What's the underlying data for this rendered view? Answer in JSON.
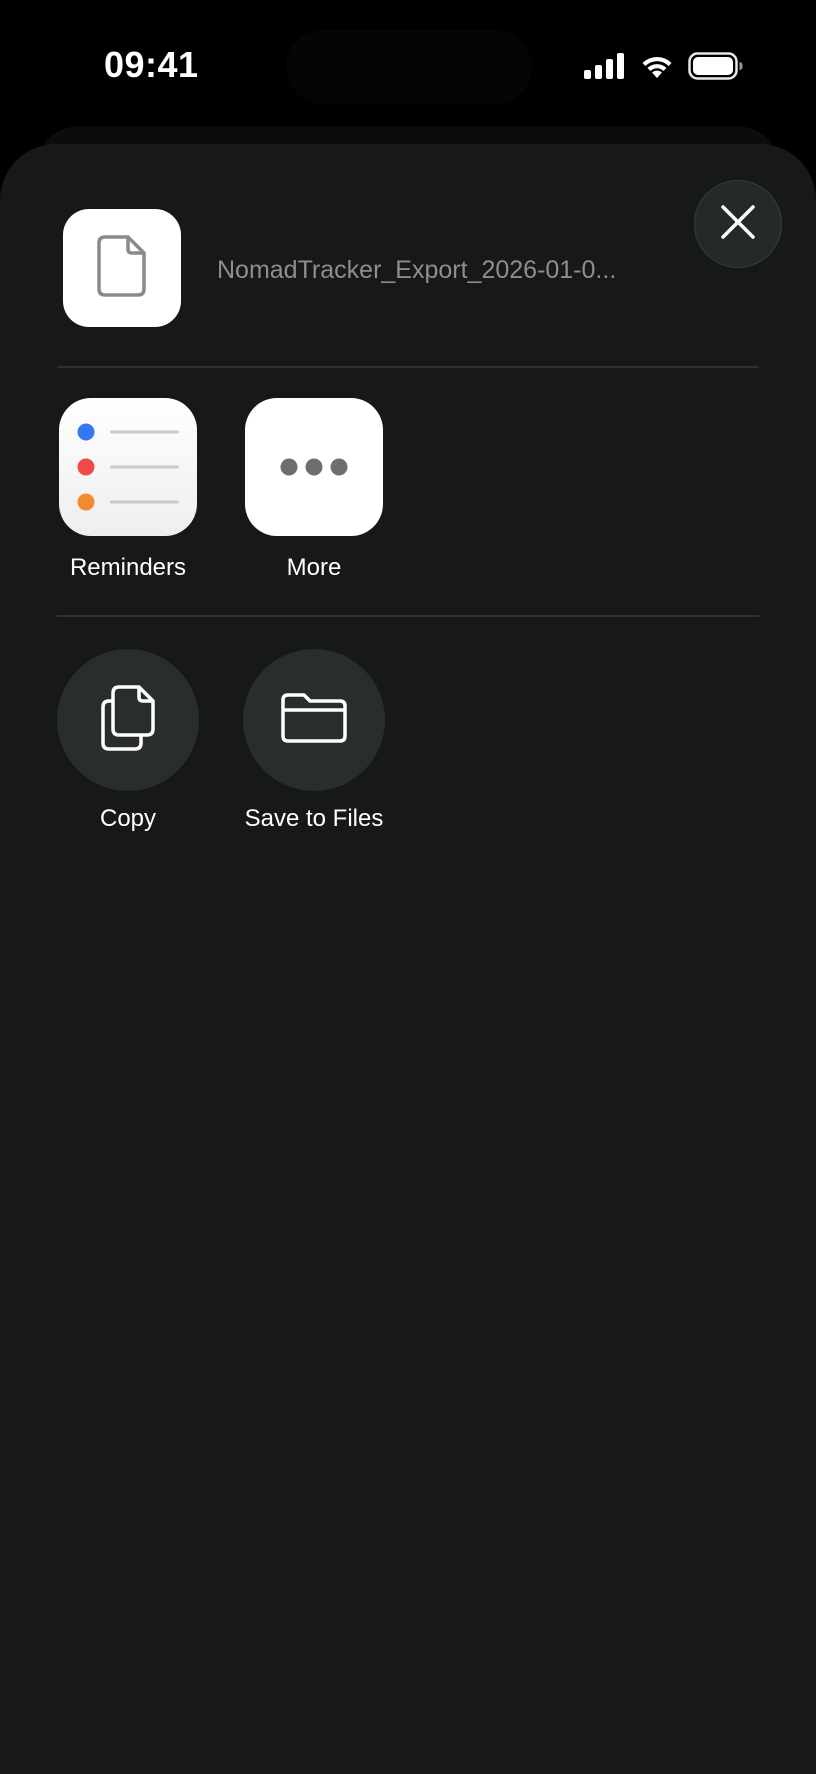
{
  "status_bar": {
    "time": "09:41",
    "icons": [
      "signal-icon",
      "wifi-icon",
      "battery-icon"
    ]
  },
  "share_sheet": {
    "file": {
      "name": "NomadTracker_Export_2026-01-0...",
      "icon": "document-icon"
    },
    "close_icon": "close-icon",
    "apps": [
      {
        "label": "Reminders",
        "icon": "reminders-app-icon"
      },
      {
        "label": "More",
        "icon": "more-icon"
      }
    ],
    "actions": [
      {
        "label": "Copy",
        "icon": "copy-icon"
      },
      {
        "label": "Save to Files",
        "icon": "folder-icon"
      }
    ]
  },
  "colors": {
    "sheet_background": "#161917",
    "action_circle": "#2a2e2b",
    "reminder_dots": [
      "#3478f6",
      "#ef4a46",
      "#f28a2e"
    ]
  }
}
